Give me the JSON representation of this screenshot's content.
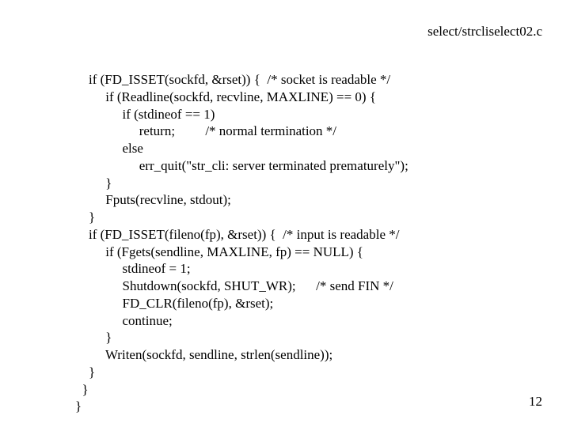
{
  "title": "select/strcliselect02.c",
  "code_lines": [
    "    if (FD_ISSET(sockfd, &rset)) {  /* socket is readable */",
    "         if (Readline(sockfd, recvline, MAXLINE) == 0) {",
    "              if (stdineof == 1)",
    "                   return;         /* normal termination */",
    "              else",
    "                   err_quit(\"str_cli: server terminated prematurely\");",
    "         }",
    "         Fputs(recvline, stdout);",
    "    }",
    "    if (FD_ISSET(fileno(fp), &rset)) {  /* input is readable */",
    "         if (Fgets(sendline, MAXLINE, fp) == NULL) {",
    "              stdineof = 1;",
    "              Shutdown(sockfd, SHUT_WR);      /* send FIN */",
    "              FD_CLR(fileno(fp), &rset);",
    "              continue;",
    "         }",
    "         Writen(sockfd, sendline, strlen(sendline));",
    "    }",
    "  }",
    "}"
  ],
  "page_number": "12"
}
